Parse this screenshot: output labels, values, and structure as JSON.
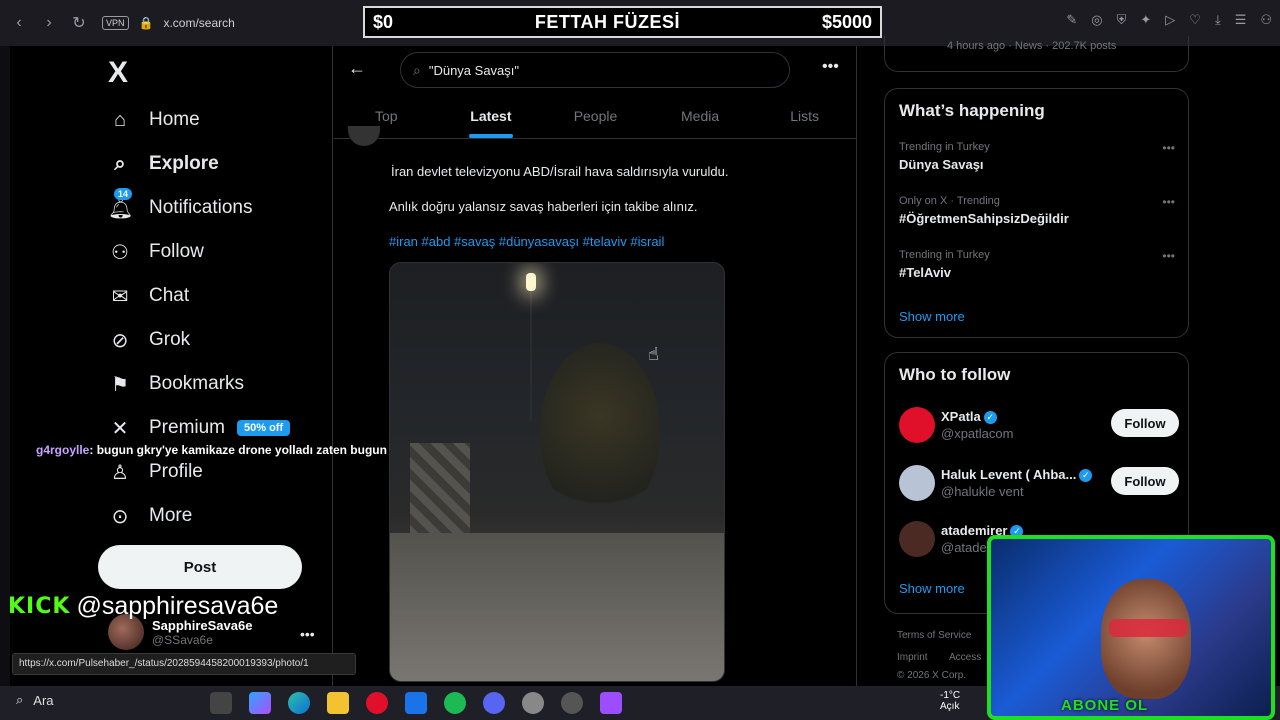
{
  "browser": {
    "vpn_label": "VPN",
    "url": "x.com/search",
    "nav_back_icon": "back-arrow-icon",
    "nav_forward_icon": "forward-arrow-icon",
    "reload_icon": "reload-icon"
  },
  "stream_banner": {
    "left_amount": "$0",
    "title": "FETTAH FÜZESİ",
    "right_amount": "$5000"
  },
  "sidebar": {
    "logo": "X",
    "items": [
      {
        "label": "Home",
        "icon": "home-icon"
      },
      {
        "label": "Explore",
        "icon": "search-icon"
      },
      {
        "label": "Notifications",
        "icon": "bell-icon",
        "badge": "14"
      },
      {
        "label": "Follow",
        "icon": "add-user-icon"
      },
      {
        "label": "Chat",
        "icon": "mail-icon"
      },
      {
        "label": "Grok",
        "icon": "grok-icon"
      },
      {
        "label": "Bookmarks",
        "icon": "bookmark-icon"
      },
      {
        "label": "Premium",
        "icon": "x-icon",
        "badge": "50% off"
      },
      {
        "label": "Profile",
        "icon": "person-icon"
      },
      {
        "label": "More",
        "icon": "more-circle-icon"
      }
    ],
    "post_label": "Post",
    "profile": {
      "name": "SapphireSava6e",
      "handle": "@SSava6e"
    }
  },
  "stream_chat": {
    "user": "g4rgoylle",
    "message": ": bugun gkry'ye kamikaze drone yolladı zaten bugun"
  },
  "kick": {
    "logo": "KICK",
    "handle": "@sapphiresava6e"
  },
  "main": {
    "search_value": "\"Dünya Savaşı\"",
    "tabs": [
      {
        "label": "Top",
        "active": false
      },
      {
        "label": "Latest",
        "active": true
      },
      {
        "label": "People",
        "active": false
      },
      {
        "label": "Media",
        "active": false
      },
      {
        "label": "Lists",
        "active": false
      }
    ],
    "tweet": {
      "text_1": "İran devlet televizyonu ABD/İsrail hava saldırısıyla vuruldu.",
      "text_2": "Anlık doğru yalansız savaş haberleri için takibe alınız.",
      "hashtags": "#iran #abd #savaş #dünyasavaşı #telaviv #israil"
    }
  },
  "right": {
    "news_meta": "4 hours ago · News · 202.7K posts",
    "whats_happening": {
      "title": "What’s happening",
      "trends": [
        {
          "context": "Trending in Turkey",
          "name": "Dünya Savaşı"
        },
        {
          "context": "Only on X · Trending",
          "name": "#ÖğretmenSahipsizDeğildir"
        },
        {
          "context": "Trending in Turkey",
          "name": "#TelAviv"
        }
      ],
      "show_more": "Show more"
    },
    "who_to_follow": {
      "title": "Who to follow",
      "accounts": [
        {
          "name": "XPatla",
          "handle": "@xpatlacom",
          "avatar_color": "#e0102a"
        },
        {
          "name": "Haluk Levent ( Ahba...",
          "handle": "@halukle vent",
          "avatar_color": "#b8c4d6"
        },
        {
          "name": "atademirer",
          "handle": "@atade",
          "avatar_color": "#4a2a22"
        }
      ],
      "follow_label": "Follow",
      "show_more": "Show more"
    },
    "footer": {
      "terms": "Terms of Service",
      "imprint": "Imprint",
      "access": "Access",
      "copyright": "© 2026 X Corp."
    }
  },
  "status_url": "https://x.com/Pulsehaber_/status/2028594458200019393/photo/1",
  "webcam": {
    "abone_text": "ABONE OL"
  },
  "taskbar": {
    "search_label": "Ara",
    "weather_temp": "-1°C",
    "weather_desc": "Açık"
  }
}
